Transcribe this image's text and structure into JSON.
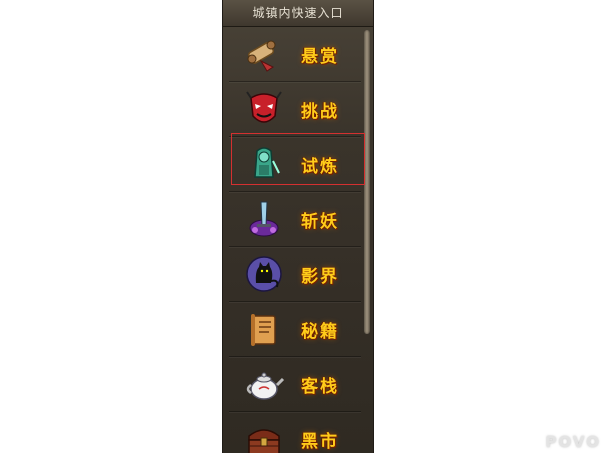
{
  "panel": {
    "title": "城镇内快速入口",
    "items": [
      {
        "label": "悬赏",
        "icon": "scroll-icon"
      },
      {
        "label": "挑战",
        "icon": "opera-mask-icon"
      },
      {
        "label": "试炼",
        "icon": "jade-warrior-icon"
      },
      {
        "label": "斩妖",
        "icon": "demon-blade-icon"
      },
      {
        "label": "影界",
        "icon": "shadow-cat-icon"
      },
      {
        "label": "秘籍",
        "icon": "manual-scroll-icon"
      },
      {
        "label": "客栈",
        "icon": "teapot-icon"
      },
      {
        "label": "黑市",
        "icon": "treasure-chest-icon"
      }
    ],
    "selected_index": 2
  },
  "watermark": "POVO"
}
